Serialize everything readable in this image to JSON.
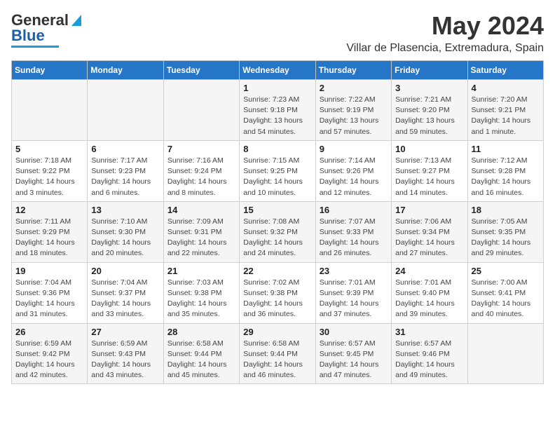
{
  "header": {
    "logo_line1": "General",
    "logo_line2": "Blue",
    "title": "May 2024",
    "subtitle": "Villar de Plasencia, Extremadura, Spain"
  },
  "weekdays": [
    "Sunday",
    "Monday",
    "Tuesday",
    "Wednesday",
    "Thursday",
    "Friday",
    "Saturday"
  ],
  "weeks": [
    {
      "days": [
        {
          "num": "",
          "info": ""
        },
        {
          "num": "",
          "info": ""
        },
        {
          "num": "",
          "info": ""
        },
        {
          "num": "1",
          "info": "Sunrise: 7:23 AM\nSunset: 9:18 PM\nDaylight: 13 hours\nand 54 minutes."
        },
        {
          "num": "2",
          "info": "Sunrise: 7:22 AM\nSunset: 9:19 PM\nDaylight: 13 hours\nand 57 minutes."
        },
        {
          "num": "3",
          "info": "Sunrise: 7:21 AM\nSunset: 9:20 PM\nDaylight: 13 hours\nand 59 minutes."
        },
        {
          "num": "4",
          "info": "Sunrise: 7:20 AM\nSunset: 9:21 PM\nDaylight: 14 hours\nand 1 minute."
        }
      ]
    },
    {
      "days": [
        {
          "num": "5",
          "info": "Sunrise: 7:18 AM\nSunset: 9:22 PM\nDaylight: 14 hours\nand 3 minutes."
        },
        {
          "num": "6",
          "info": "Sunrise: 7:17 AM\nSunset: 9:23 PM\nDaylight: 14 hours\nand 6 minutes."
        },
        {
          "num": "7",
          "info": "Sunrise: 7:16 AM\nSunset: 9:24 PM\nDaylight: 14 hours\nand 8 minutes."
        },
        {
          "num": "8",
          "info": "Sunrise: 7:15 AM\nSunset: 9:25 PM\nDaylight: 14 hours\nand 10 minutes."
        },
        {
          "num": "9",
          "info": "Sunrise: 7:14 AM\nSunset: 9:26 PM\nDaylight: 14 hours\nand 12 minutes."
        },
        {
          "num": "10",
          "info": "Sunrise: 7:13 AM\nSunset: 9:27 PM\nDaylight: 14 hours\nand 14 minutes."
        },
        {
          "num": "11",
          "info": "Sunrise: 7:12 AM\nSunset: 9:28 PM\nDaylight: 14 hours\nand 16 minutes."
        }
      ]
    },
    {
      "days": [
        {
          "num": "12",
          "info": "Sunrise: 7:11 AM\nSunset: 9:29 PM\nDaylight: 14 hours\nand 18 minutes."
        },
        {
          "num": "13",
          "info": "Sunrise: 7:10 AM\nSunset: 9:30 PM\nDaylight: 14 hours\nand 20 minutes."
        },
        {
          "num": "14",
          "info": "Sunrise: 7:09 AM\nSunset: 9:31 PM\nDaylight: 14 hours\nand 22 minutes."
        },
        {
          "num": "15",
          "info": "Sunrise: 7:08 AM\nSunset: 9:32 PM\nDaylight: 14 hours\nand 24 minutes."
        },
        {
          "num": "16",
          "info": "Sunrise: 7:07 AM\nSunset: 9:33 PM\nDaylight: 14 hours\nand 26 minutes."
        },
        {
          "num": "17",
          "info": "Sunrise: 7:06 AM\nSunset: 9:34 PM\nDaylight: 14 hours\nand 27 minutes."
        },
        {
          "num": "18",
          "info": "Sunrise: 7:05 AM\nSunset: 9:35 PM\nDaylight: 14 hours\nand 29 minutes."
        }
      ]
    },
    {
      "days": [
        {
          "num": "19",
          "info": "Sunrise: 7:04 AM\nSunset: 9:36 PM\nDaylight: 14 hours\nand 31 minutes."
        },
        {
          "num": "20",
          "info": "Sunrise: 7:04 AM\nSunset: 9:37 PM\nDaylight: 14 hours\nand 33 minutes."
        },
        {
          "num": "21",
          "info": "Sunrise: 7:03 AM\nSunset: 9:38 PM\nDaylight: 14 hours\nand 35 minutes."
        },
        {
          "num": "22",
          "info": "Sunrise: 7:02 AM\nSunset: 9:38 PM\nDaylight: 14 hours\nand 36 minutes."
        },
        {
          "num": "23",
          "info": "Sunrise: 7:01 AM\nSunset: 9:39 PM\nDaylight: 14 hours\nand 37 minutes."
        },
        {
          "num": "24",
          "info": "Sunrise: 7:01 AM\nSunset: 9:40 PM\nDaylight: 14 hours\nand 39 minutes."
        },
        {
          "num": "25",
          "info": "Sunrise: 7:00 AM\nSunset: 9:41 PM\nDaylight: 14 hours\nand 40 minutes."
        }
      ]
    },
    {
      "days": [
        {
          "num": "26",
          "info": "Sunrise: 6:59 AM\nSunset: 9:42 PM\nDaylight: 14 hours\nand 42 minutes."
        },
        {
          "num": "27",
          "info": "Sunrise: 6:59 AM\nSunset: 9:43 PM\nDaylight: 14 hours\nand 43 minutes."
        },
        {
          "num": "28",
          "info": "Sunrise: 6:58 AM\nSunset: 9:44 PM\nDaylight: 14 hours\nand 45 minutes."
        },
        {
          "num": "29",
          "info": "Sunrise: 6:58 AM\nSunset: 9:44 PM\nDaylight: 14 hours\nand 46 minutes."
        },
        {
          "num": "30",
          "info": "Sunrise: 6:57 AM\nSunset: 9:45 PM\nDaylight: 14 hours\nand 47 minutes."
        },
        {
          "num": "31",
          "info": "Sunrise: 6:57 AM\nSunset: 9:46 PM\nDaylight: 14 hours\nand 49 minutes."
        },
        {
          "num": "",
          "info": ""
        }
      ]
    }
  ]
}
